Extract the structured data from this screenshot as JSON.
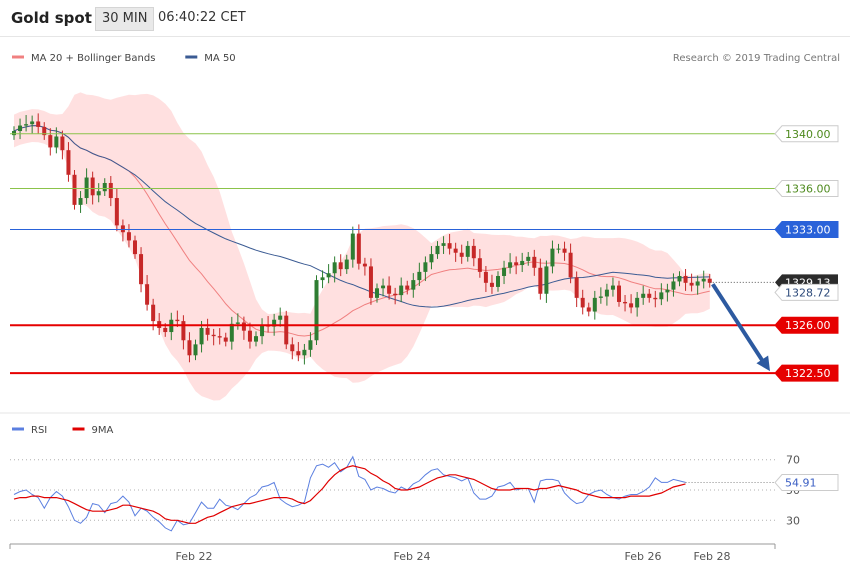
{
  "header": {
    "title": "Gold spot",
    "interval": "30 MIN",
    "time": "06:40:22 CET"
  },
  "legend": {
    "main": [
      {
        "label": "MA 20 + Bollinger Bands",
        "color": "#f08080"
      },
      {
        "label": "MA 50",
        "color": "#3b5b93"
      }
    ],
    "rsi": [
      {
        "label": "RSI",
        "color": "#5b7fe0"
      },
      {
        "label": "9MA",
        "color": "#e00000"
      }
    ],
    "credit": "Research © 2019 Trading Central"
  },
  "colors": {
    "up": "#2e7d32",
    "down": "#c62828",
    "pivot": "#2962d9",
    "support": "#e60000",
    "resistance": "#8bc34a",
    "rsi": "#5b7fe0",
    "rsi_ma": "#e00000",
    "arrow": "#2d5aa0"
  },
  "chart_data": [
    {
      "type": "candlestick",
      "ylim": [
        1319.8,
        1343.2
      ],
      "x_ticks": [
        "Feb 22",
        "Feb 24",
        "Feb 26",
        "Feb 28"
      ],
      "levels": [
        {
          "value": 1340.0,
          "label": "1340.00",
          "kind": "resistance"
        },
        {
          "value": 1336.0,
          "label": "1336.00",
          "kind": "resistance"
        },
        {
          "value": 1333.0,
          "label": "1333.00",
          "kind": "pivot"
        },
        {
          "value": 1326.0,
          "label": "1326.00",
          "kind": "support"
        },
        {
          "value": 1322.5,
          "label": "1322.50",
          "kind": "support"
        }
      ],
      "last_price": {
        "value": 1329.13,
        "label": "1329.13"
      },
      "ma50_last": {
        "value": 1328.72,
        "label": "1328.72"
      },
      "projection": {
        "from": 1329.0,
        "to": 1322.5
      },
      "closes": [
        1340.2,
        1340.6,
        1340.7,
        1340.9,
        1340.5,
        1339.9,
        1339.0,
        1339.8,
        1338.8,
        1337.0,
        1334.8,
        1335.3,
        1336.8,
        1335.5,
        1335.8,
        1336.4,
        1335.3,
        1333.3,
        1332.8,
        1332.2,
        1331.2,
        1329.0,
        1327.5,
        1326.3,
        1325.8,
        1325.5,
        1326.4,
        1326.3,
        1324.9,
        1323.8,
        1324.6,
        1325.8,
        1325.3,
        1325.2,
        1325.1,
        1324.8,
        1326.1,
        1326.2,
        1325.6,
        1324.8,
        1325.2,
        1326.0,
        1325.9,
        1326.4,
        1326.7,
        1324.6,
        1324.1,
        1323.8,
        1324.2,
        1324.9,
        1329.3,
        1329.5,
        1329.8,
        1330.6,
        1330.1,
        1330.8,
        1332.7,
        1330.5,
        1330.3,
        1328.0,
        1328.7,
        1328.9,
        1328.3,
        1328.2,
        1328.9,
        1328.6,
        1329.3,
        1329.9,
        1330.6,
        1331.2,
        1331.8,
        1332.0,
        1331.6,
        1331.3,
        1331.0,
        1331.8,
        1330.9,
        1329.9,
        1329.1,
        1328.8,
        1329.6,
        1330.2,
        1330.6,
        1330.4,
        1330.7,
        1331.0,
        1330.2,
        1328.3,
        1330.3,
        1331.6,
        1331.6,
        1331.3,
        1329.5,
        1328.0,
        1327.3,
        1327.0,
        1328.0,
        1328.1,
        1328.6,
        1328.9,
        1327.7,
        1327.6,
        1327.3,
        1328.0,
        1328.3,
        1328.0,
        1327.9,
        1328.4,
        1328.6,
        1329.2,
        1329.6,
        1329.1,
        1328.9,
        1329.2,
        1329.4,
        1329.1
      ]
    },
    {
      "type": "line",
      "title": "RSI",
      "ylim": [
        17,
        83
      ],
      "y_ticks": [
        30,
        50,
        70
      ],
      "last_value": {
        "value": 54.91,
        "label": "54.91"
      },
      "series": [
        {
          "name": "RSI",
          "values": [
            47,
            49,
            50,
            47,
            45,
            38,
            45,
            49,
            46,
            39,
            30,
            28,
            32,
            41,
            40,
            35,
            41,
            42,
            46,
            42,
            33,
            38,
            36,
            32,
            29,
            25,
            23,
            30,
            27,
            28,
            35,
            42,
            38,
            38,
            44,
            40,
            39,
            37,
            41,
            45,
            47,
            52,
            53,
            55,
            44,
            41,
            39,
            40,
            42,
            58,
            66,
            67,
            65,
            68,
            62,
            65,
            72,
            59,
            57,
            50,
            52,
            51,
            49,
            48,
            52,
            50,
            54,
            56,
            60,
            63,
            64,
            60,
            59,
            58,
            56,
            58,
            48,
            44,
            44,
            46,
            52,
            53,
            55,
            50,
            51,
            51,
            42,
            56,
            57,
            57,
            56,
            48,
            44,
            41,
            42,
            47,
            49,
            50,
            47,
            45,
            44,
            46,
            47,
            47,
            49,
            52,
            58,
            55,
            55,
            57,
            56,
            55
          ]
        },
        {
          "name": "9MA",
          "values": [
            44,
            45,
            45,
            46,
            46,
            45,
            45,
            45,
            44,
            43,
            41,
            39,
            37,
            36,
            36,
            36,
            37,
            38,
            40,
            40,
            39,
            38,
            37,
            36,
            34,
            31,
            30,
            30,
            29,
            28,
            28,
            30,
            32,
            33,
            35,
            37,
            39,
            40,
            41,
            41,
            42,
            43,
            44,
            45,
            45,
            45,
            44,
            42,
            41,
            43,
            47,
            51,
            56,
            60,
            63,
            65,
            66,
            65,
            64,
            61,
            59,
            56,
            54,
            51,
            50,
            50,
            51,
            52,
            54,
            56,
            58,
            59,
            60,
            60,
            59,
            58,
            57,
            55,
            53,
            51,
            50,
            50,
            50,
            51,
            51,
            51,
            50,
            51,
            51,
            52,
            53,
            52,
            51,
            50,
            48,
            47,
            46,
            45,
            45,
            45,
            45,
            45,
            46,
            46,
            46,
            46,
            47,
            48,
            50,
            52,
            53,
            54
          ]
        }
      ]
    }
  ]
}
